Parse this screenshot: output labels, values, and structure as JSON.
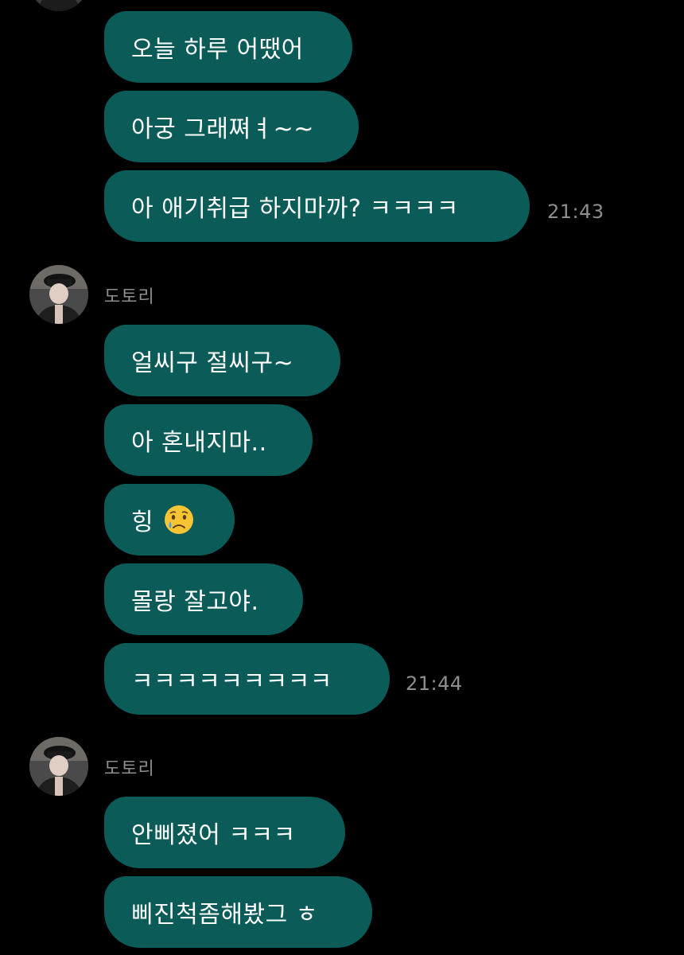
{
  "theme": {
    "background": "#000000",
    "bubble_color": "#0b5b58",
    "meta_text_color": "#8e8e8e",
    "text_color": "#ffffff"
  },
  "groups": [
    {
      "messages": [
        {
          "text": "오늘 하루 어땠어"
        },
        {
          "text": "아궁 그래쪄ㅕ~~"
        },
        {
          "text": "아 애기취급 하지마까? ㅋㅋㅋㅋ"
        }
      ],
      "time": "21:43"
    },
    {
      "sender": "도토리",
      "messages": [
        {
          "text": "얼씨구 절씨구~"
        },
        {
          "text": "아 혼내지마.."
        },
        {
          "text": "힝",
          "emoji": "crying-face"
        },
        {
          "text": "몰랑 잘고야."
        },
        {
          "text": "ㅋㅋㅋㅋㅋㅋㅋㅋㅋ"
        }
      ],
      "time": "21:44"
    },
    {
      "sender": "도토리",
      "messages": [
        {
          "text": "안삐졌어 ㅋㅋㅋ"
        },
        {
          "text": "삐진척좀해봤그 ㅎ"
        }
      ]
    }
  ]
}
